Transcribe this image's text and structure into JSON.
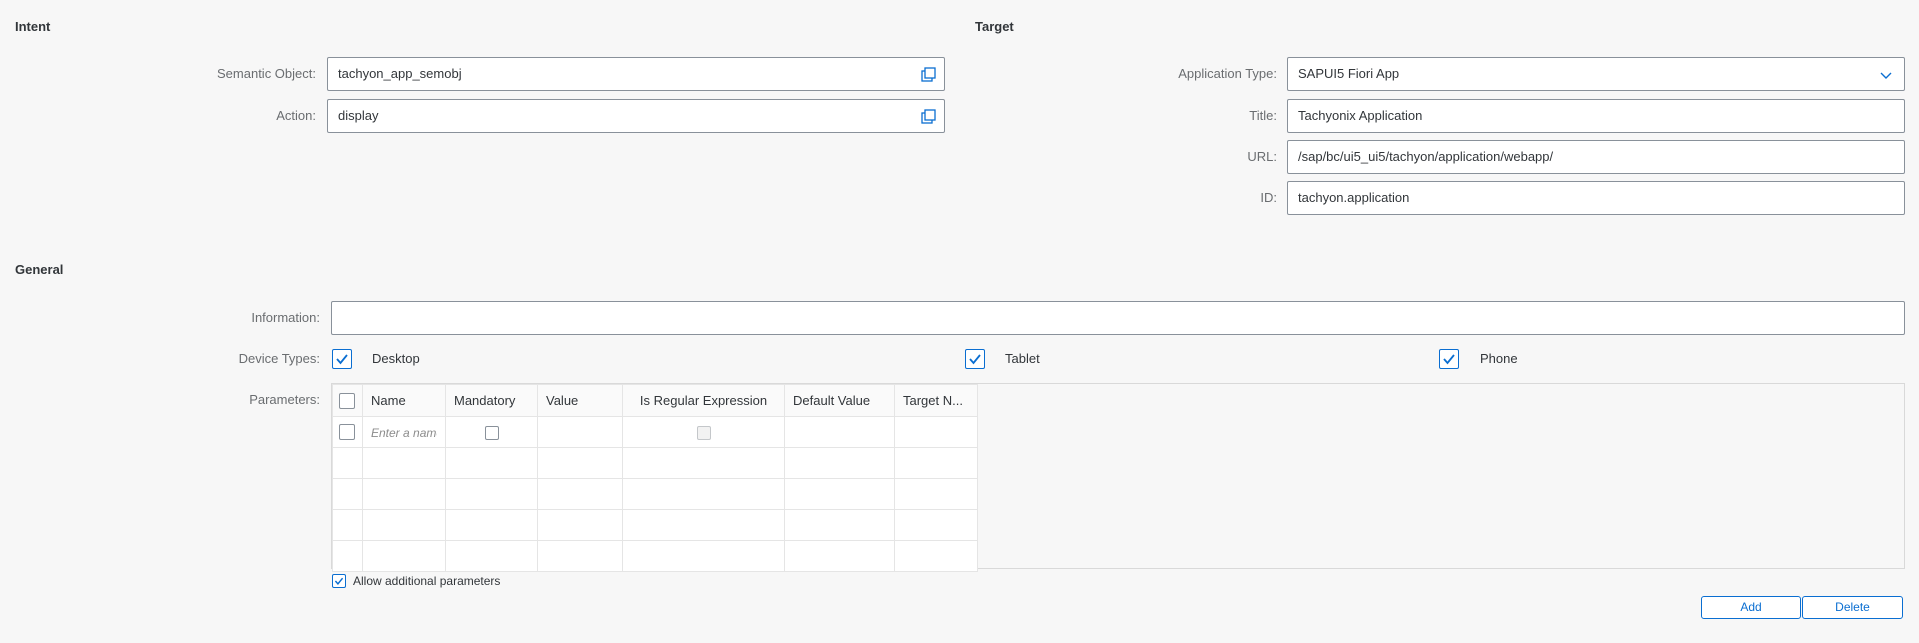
{
  "intent": {
    "title": "Intent",
    "semantic_object": {
      "label": "Semantic Object:",
      "value": "tachyon_app_semobj",
      "icon": "value-help-icon"
    },
    "action": {
      "label": "Action:",
      "value": "display",
      "icon": "value-help-icon"
    }
  },
  "target": {
    "title": "Target",
    "application_type": {
      "label": "Application Type:",
      "value": "SAPUI5 Fiori App",
      "icon": "chevron-down-icon"
    },
    "title_field": {
      "label": "Title:",
      "value": "Tachyonix Application"
    },
    "url": {
      "label": "URL:",
      "value": "/sap/bc/ui5_ui5/tachyon/application/webapp/"
    },
    "id": {
      "label": "ID:",
      "value": "tachyon.application"
    }
  },
  "general": {
    "title": "General",
    "information": {
      "label": "Information:",
      "value": ""
    },
    "device_types": {
      "label": "Device Types:",
      "desktop": {
        "label": "Desktop",
        "checked": true
      },
      "tablet": {
        "label": "Tablet",
        "checked": true
      },
      "phone": {
        "label": "Phone",
        "checked": true
      }
    },
    "parameters": {
      "label": "Parameters:",
      "columns": [
        "Name",
        "Mandatory",
        "Value",
        "Is Regular Expression",
        "Default Value",
        "Target N..."
      ],
      "name_placeholder": "Enter a name"
    },
    "allow_additional": {
      "label": "Allow additional parameters",
      "checked": true
    },
    "buttons": {
      "add": "Add",
      "delete": "Delete"
    }
  },
  "colors": {
    "accent": "#0a6ed1",
    "background": "#f7f7f7",
    "border": "#89919a"
  }
}
